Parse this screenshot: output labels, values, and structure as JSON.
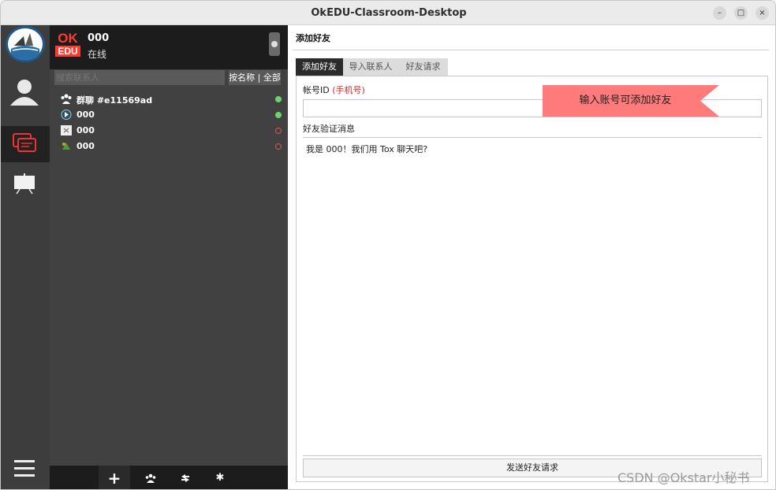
{
  "window": {
    "title": "OkEDU-Classroom-Desktop",
    "minimize": "–",
    "maximize": "□",
    "close": "×"
  },
  "profile": {
    "logo_top": "OK",
    "logo_bottom": "EDU",
    "name": "000",
    "status": "在线"
  },
  "contacts": {
    "search_placeholder": "搜索联系人",
    "sort_label": "按名称 | 全部",
    "items": [
      {
        "icon": "group-icon",
        "name": "群聊 #e11569ad",
        "status": "online"
      },
      {
        "icon": "avatar-icon",
        "name": "000",
        "status": "online"
      },
      {
        "icon": "avatar-icon",
        "name": "000",
        "status": "offline"
      },
      {
        "icon": "avatar-icon",
        "name": "000",
        "status": "offline"
      }
    ],
    "bottom_actions": [
      "add-icon",
      "group-add-icon",
      "transfer-icon",
      "settings-icon"
    ],
    "add_glyph": "+",
    "settings_glyph": "✱"
  },
  "main": {
    "header": "添加好友",
    "tabs": [
      {
        "label": "添加好友",
        "active": true
      },
      {
        "label": "导入联系人",
        "active": false
      },
      {
        "label": "好友请求",
        "active": false
      }
    ],
    "id_label": "帐号ID ",
    "id_hint": "(手机号)",
    "id_value": "",
    "message_label": "好友验证消息",
    "message_value": "我是 000！我们用 Tox 聊天吧?",
    "send_button": "发送好友请求",
    "tooltip": "输入账号可添加好友"
  },
  "watermark": "CSDN @Okstar小秘书",
  "colors": {
    "accent_red": "#ff3b30",
    "online": "#6bd36b",
    "offline": "#e05555",
    "tooltip": "#ff7b7b"
  }
}
